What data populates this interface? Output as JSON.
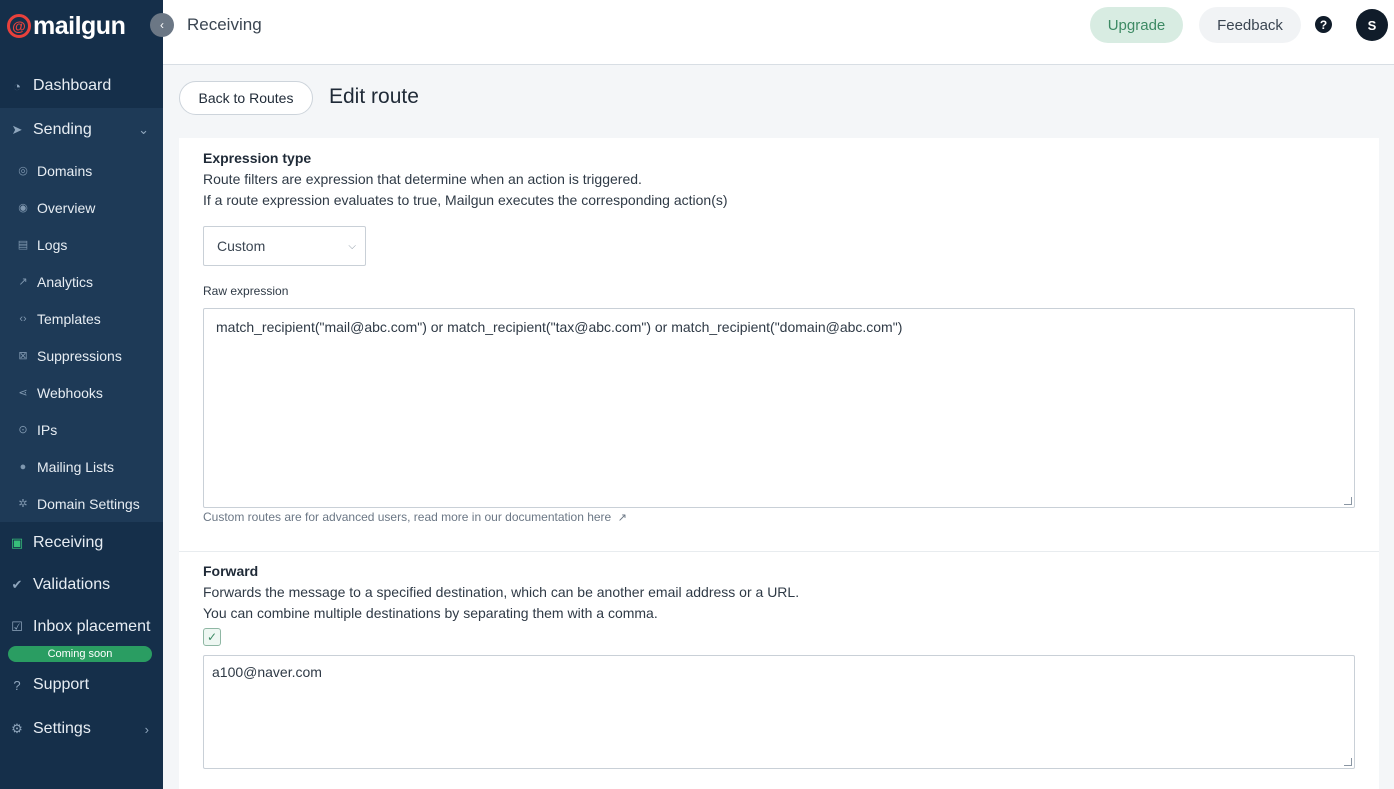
{
  "brand": {
    "name": "mailgun",
    "accent": "#e8413c"
  },
  "sidebar": {
    "main": [
      {
        "label": "Dashboard",
        "icon": "dashboard-icon"
      },
      {
        "label": "Sending",
        "icon": "paper-plane-icon"
      },
      {
        "label": "Receiving",
        "icon": "inbox-icon"
      },
      {
        "label": "Validations",
        "icon": "user-check-icon"
      },
      {
        "label": "Inbox placement",
        "icon": "checkbox-icon"
      },
      {
        "label": "Support",
        "icon": "question-icon"
      },
      {
        "label": "Settings",
        "icon": "gear-icon"
      }
    ],
    "sub": [
      {
        "label": "Domains",
        "icon": "globe-icon"
      },
      {
        "label": "Overview",
        "icon": "eye-icon"
      },
      {
        "label": "Logs",
        "icon": "document-icon"
      },
      {
        "label": "Analytics",
        "icon": "chart-line-icon"
      },
      {
        "label": "Templates",
        "icon": "code-icon"
      },
      {
        "label": "Suppressions",
        "icon": "block-icon"
      },
      {
        "label": "Webhooks",
        "icon": "share-icon"
      },
      {
        "label": "IPs",
        "icon": "pin-icon"
      },
      {
        "label": "Mailing Lists",
        "icon": "person-icon"
      },
      {
        "label": "Domain Settings",
        "icon": "cog-icon"
      }
    ],
    "badge": "Coming soon"
  },
  "topbar": {
    "title": "Receiving",
    "upgrade": "Upgrade",
    "feedback": "Feedback",
    "help": "?",
    "avatar": "S"
  },
  "page": {
    "back": "Back to Routes",
    "title": "Edit route"
  },
  "expression": {
    "title": "Expression type",
    "desc1": "Route filters are expression that determine when an action is triggered.",
    "desc2": "If a route expression evaluates to true, Mailgun executes the corresponding action(s)",
    "type_value": "Custom",
    "raw_label": "Raw expression",
    "raw_value": "match_recipient(\"mail@abc.com\") or match_recipient(\"tax@abc.com\") or match_recipient(\"domain@abc.com\")",
    "hint": "Custom routes are for advanced users, read more in our documentation here"
  },
  "forward": {
    "title": "Forward",
    "desc1": "Forwards the message to a specified destination, which can be another email address or a URL.",
    "desc2": "You can combine multiple destinations by separating them with a comma.",
    "checked": true,
    "value": "a100@naver.com"
  }
}
